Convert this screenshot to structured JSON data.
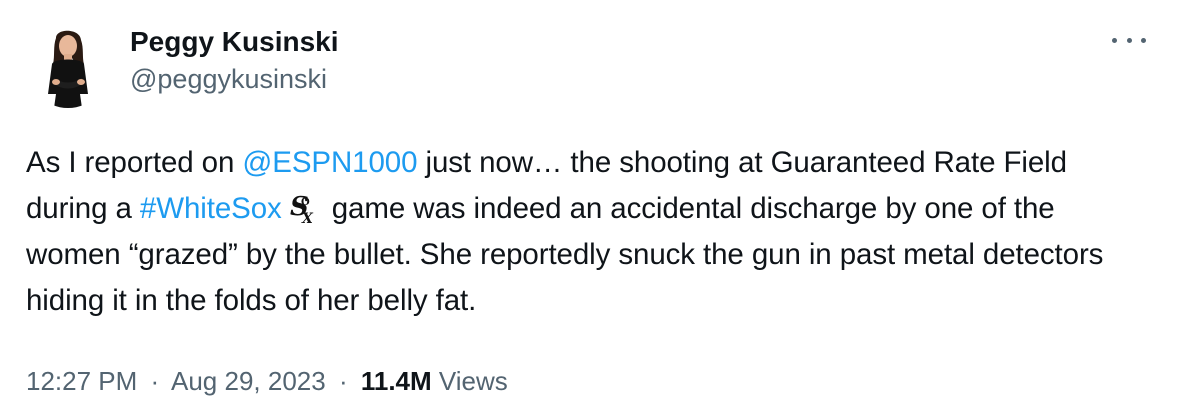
{
  "author": {
    "display_name": "Peggy Kusinski",
    "handle": "@peggykusinski"
  },
  "more_menu": {
    "icon": "more-horizontal-icon"
  },
  "tweet": {
    "text_parts": [
      "As I reported on ",
      "@ESPN1000",
      " just now… the shooting at Guaranteed Rate Field during a ",
      "#WhiteSox",
      " game was indeed an accidental discharge by one of the women “grazed” by the bullet.  She reportedly snuck the gun in past metal detectors hiding it in the folds of her belly fat."
    ],
    "emoji": "white-sox-logo-emoji"
  },
  "meta": {
    "time": "12:27 PM",
    "separator": "·",
    "date": "Aug 29, 2023",
    "views_count": "11.4M",
    "views_label": "Views"
  },
  "colors": {
    "link": "#1d9bf0",
    "text": "#0f1419",
    "secondary": "#536471"
  }
}
